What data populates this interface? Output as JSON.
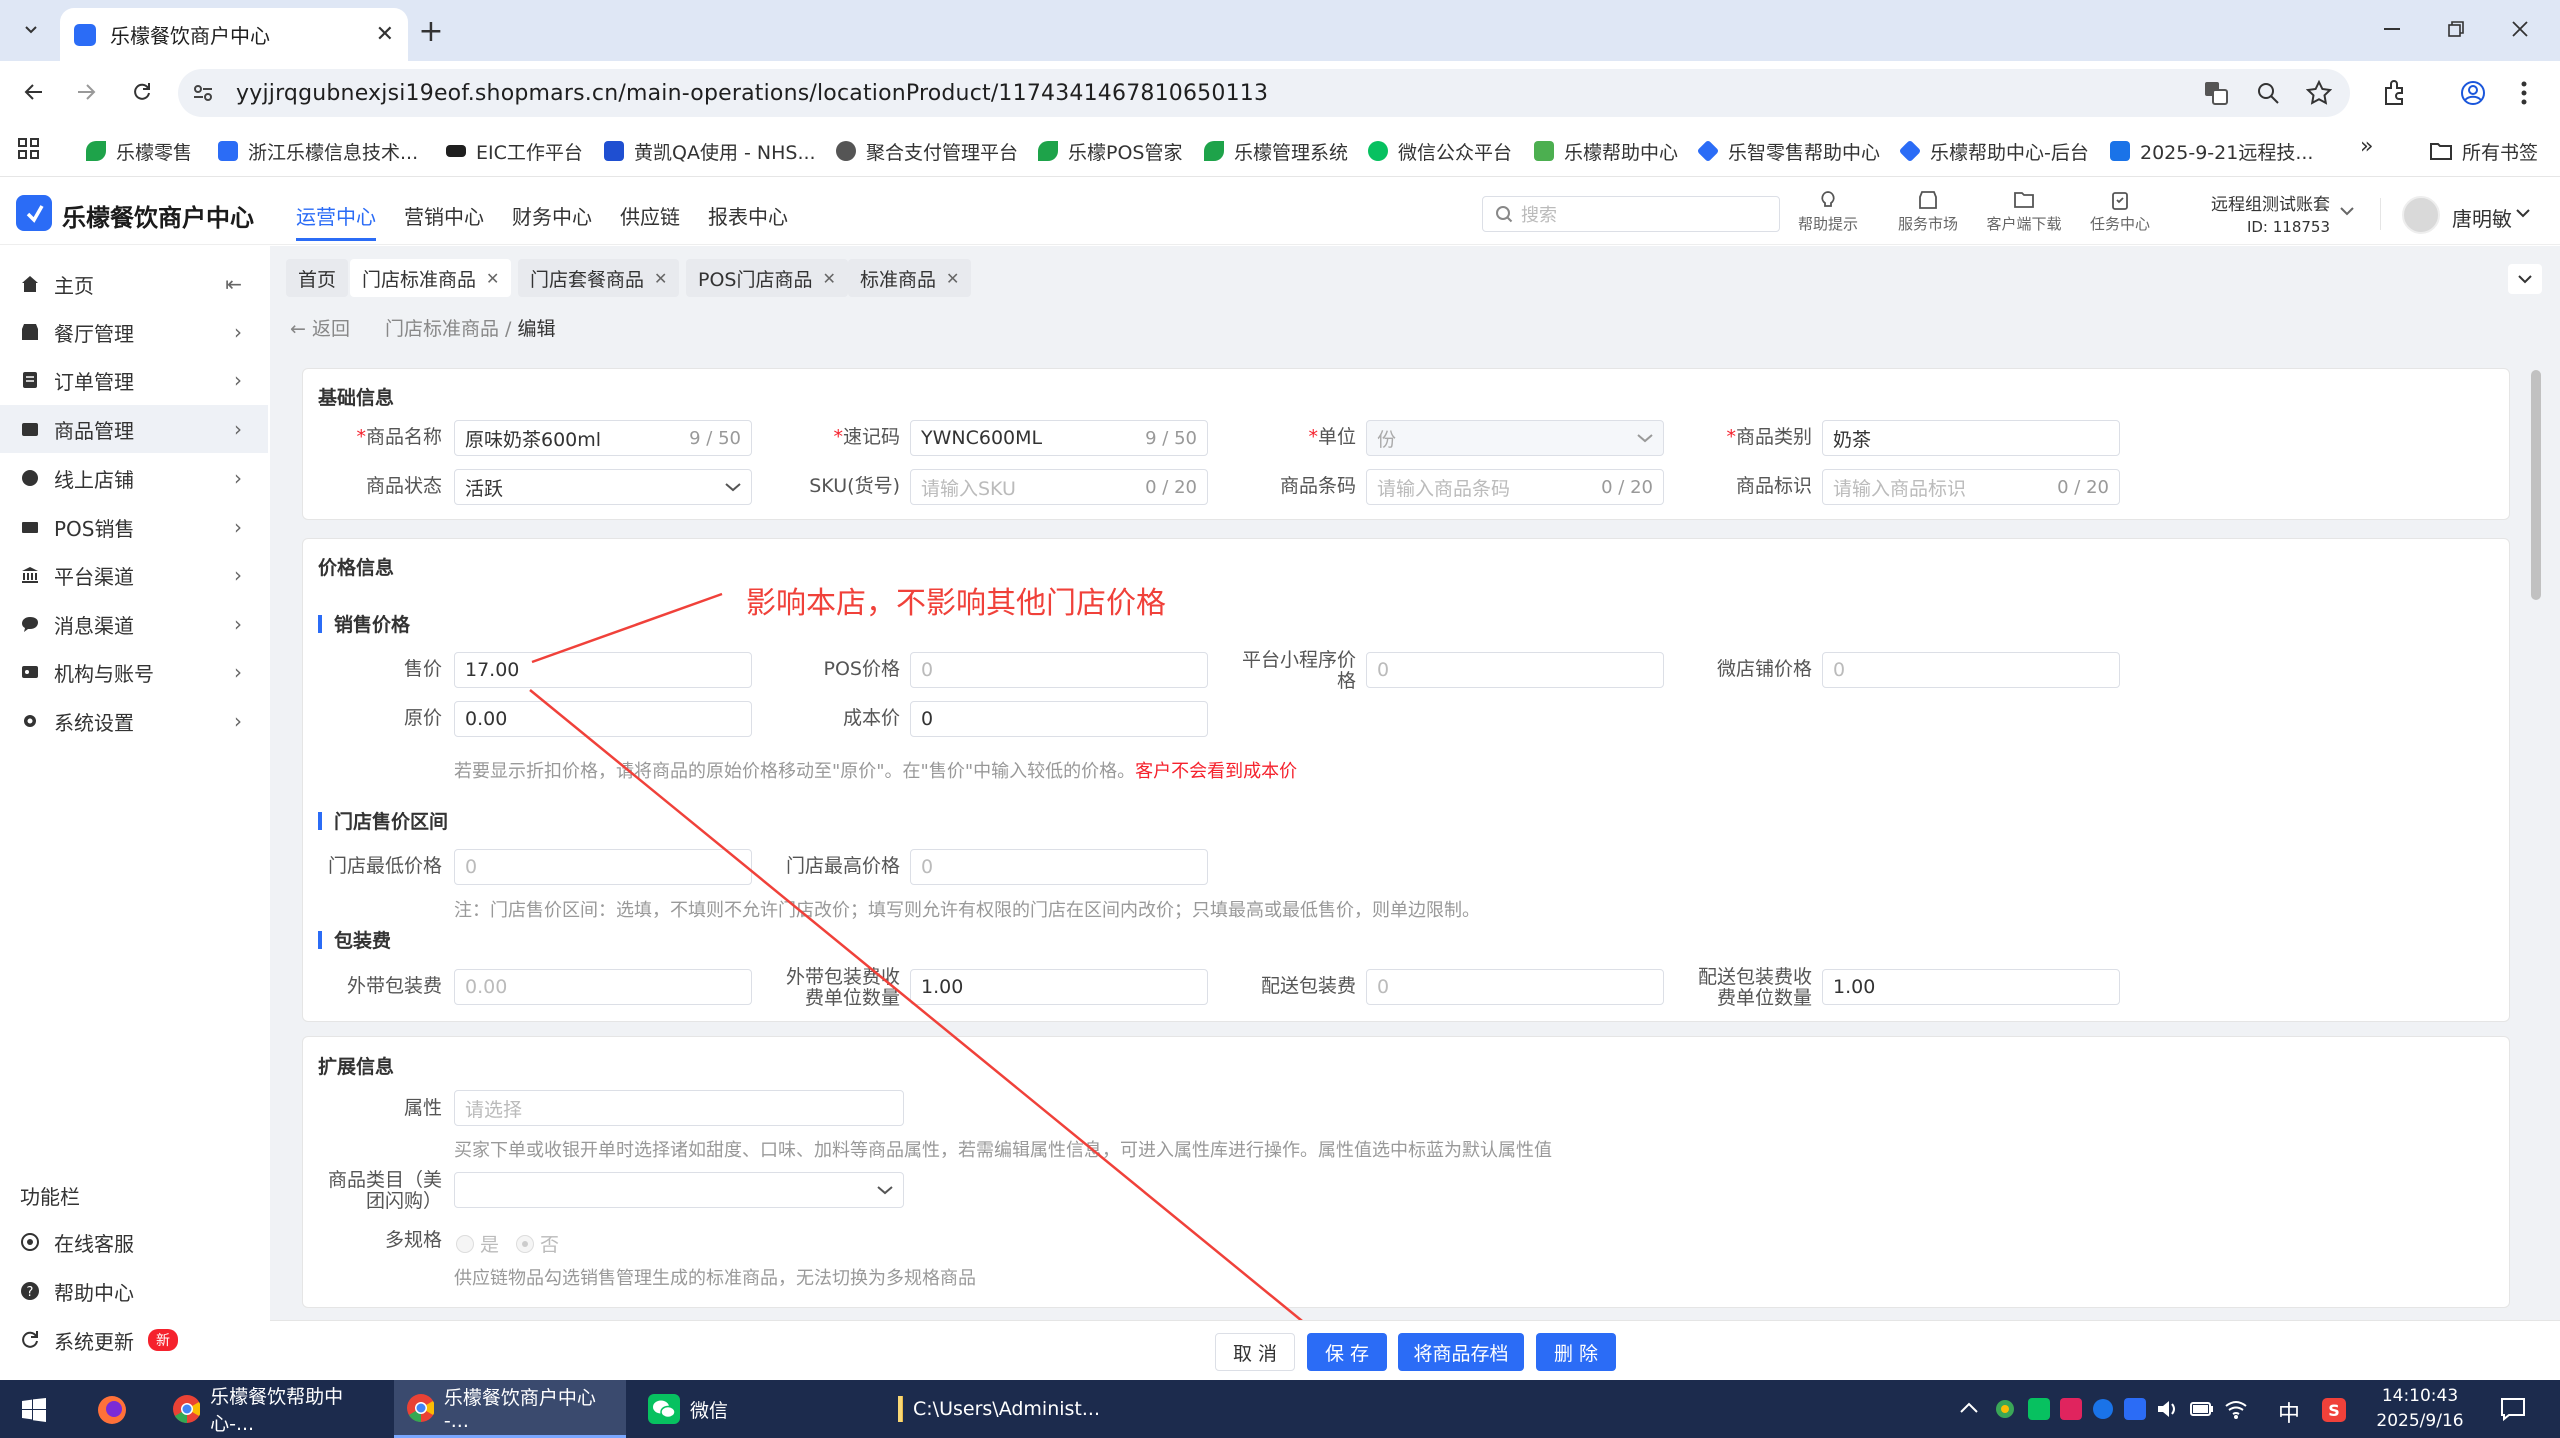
{
  "browser": {
    "tabs": [
      {
        "title": "乐檬餐饮商户中心"
      }
    ],
    "url": "yyjjrqgubnexjsi19eof.shopmars.cn/main-operations/locationProduct/1174341467810650113",
    "bookmarks": [
      "乐檬零售",
      "浙江乐檬信息技术...",
      "EIC工作平台",
      "黄凯QA使用 - NHS...",
      "聚合支付管理平台",
      "乐檬POS管家",
      "乐檬管理系统",
      "微信公众平台",
      "乐檬帮助中心",
      "乐智零售帮助中心",
      "乐檬帮助中心-后台",
      "2025-9-21远程技..."
    ],
    "all_bookmarks": "所有书签"
  },
  "app": {
    "title": "乐檬餐饮商户中心",
    "nav": [
      "运营中心",
      "营销中心",
      "财务中心",
      "供应链",
      "报表中心"
    ],
    "search_placeholder": "搜索",
    "header_icons": [
      "帮助提示",
      "服务市场",
      "客户端下载",
      "任务中心"
    ],
    "account": "远程组测试账套",
    "account_id": "ID: 118753",
    "user": "唐明敏"
  },
  "sidebar": {
    "items": [
      "主页",
      "餐厅管理",
      "订单管理",
      "商品管理",
      "线上店铺",
      "POS销售",
      "平台渠道",
      "消息渠道",
      "机构与账号",
      "系统设置"
    ],
    "func_title": "功能栏",
    "func_items": [
      "在线客服",
      "帮助中心",
      "系统更新"
    ],
    "new_badge": "新"
  },
  "page_tabs": [
    "首页",
    "门店标准商品",
    "门店套餐商品",
    "POS门店商品",
    "标准商品"
  ],
  "breadcrumb": {
    "back": "返回",
    "parent": "门店标准商品",
    "current": "编辑"
  },
  "basic": {
    "title": "基础信息",
    "name_label": "商品名称",
    "name": "原味奶茶600ml",
    "name_count": "9 / 50",
    "code_label": "速记码",
    "code": "YWNC600ML",
    "code_count": "9 / 50",
    "unit_label": "单位",
    "unit": "份",
    "category_label": "商品类别",
    "category": "奶茶",
    "status_label": "商品状态",
    "status": "活跃",
    "sku_label": "SKU(货号)",
    "sku_ph": "请输入SKU",
    "sku_count": "0 / 20",
    "barcode_label": "商品条码",
    "barcode_ph": "请输入商品条码",
    "barcode_count": "0 / 20",
    "tag_label": "商品标识",
    "tag_ph": "请输入商品标识",
    "tag_count": "0 / 20"
  },
  "price": {
    "title": "价格信息",
    "sale_title": "销售价格",
    "price_label": "售价",
    "price": "17.00",
    "pos_label": "POS价格",
    "pos": "0",
    "mini_label": "平台小程序价格",
    "mini": "0",
    "wx_label": "微店铺价格",
    "wx": "0",
    "orig_label": "原价",
    "orig": "0.00",
    "cost_label": "成本价",
    "cost": "0",
    "hint": "若要显示折扣价格，请将商品的原始价格移动至\"原价\"。在\"售价\"中输入较低的价格。",
    "hint_red": "客户不会看到成本价",
    "range_title": "门店售价区间",
    "min_label": "门店最低价格",
    "min": "0",
    "max_label": "门店最高价格",
    "max": "0",
    "range_hint": "注：门店售价区间：选填，不填则不允许门店改价；填写则允许有权限的门店在区间内改价；只填最高或最低售价，则单边限制。",
    "pack_title": "包装费",
    "pack_out_label": "外带包装费",
    "pack_out": "0.00",
    "pack_out_qty_label": "外带包装费收费单位数量",
    "pack_out_qty": "1.00",
    "pack_del_label": "配送包装费",
    "pack_del": "0",
    "pack_del_qty_label": "配送包装费收费单位数量",
    "pack_del_qty": "1.00"
  },
  "annotation": "影响本店，不影响其他门店价格",
  "ext": {
    "title": "扩展信息",
    "attr_label": "属性",
    "attr_ph": "请选择",
    "attr_hint": "买家下单或收银开单时选择诸如甜度、口味、加料等商品属性，若需编辑属性信息，可进入属性库进行操作。属性值选中标蓝为默认属性值",
    "cat_label": "商品类目（美团闪购）",
    "multi_label": "多规格",
    "yes": "是",
    "no": "否",
    "multi_hint": "供应链物品勾选销售管理生成的标准商品，无法切换为多规格商品"
  },
  "buttons": {
    "cancel": "取 消",
    "save": "保 存",
    "archive": "将商品存档",
    "delete": "删 除"
  },
  "taskbar": {
    "items": [
      "乐檬餐饮帮助中心-...",
      "乐檬餐饮商户中心 -...",
      "微信",
      "C:\\Users\\Administ..."
    ],
    "ime": "中",
    "time": "14:10:43",
    "date": "2025/9/16"
  }
}
